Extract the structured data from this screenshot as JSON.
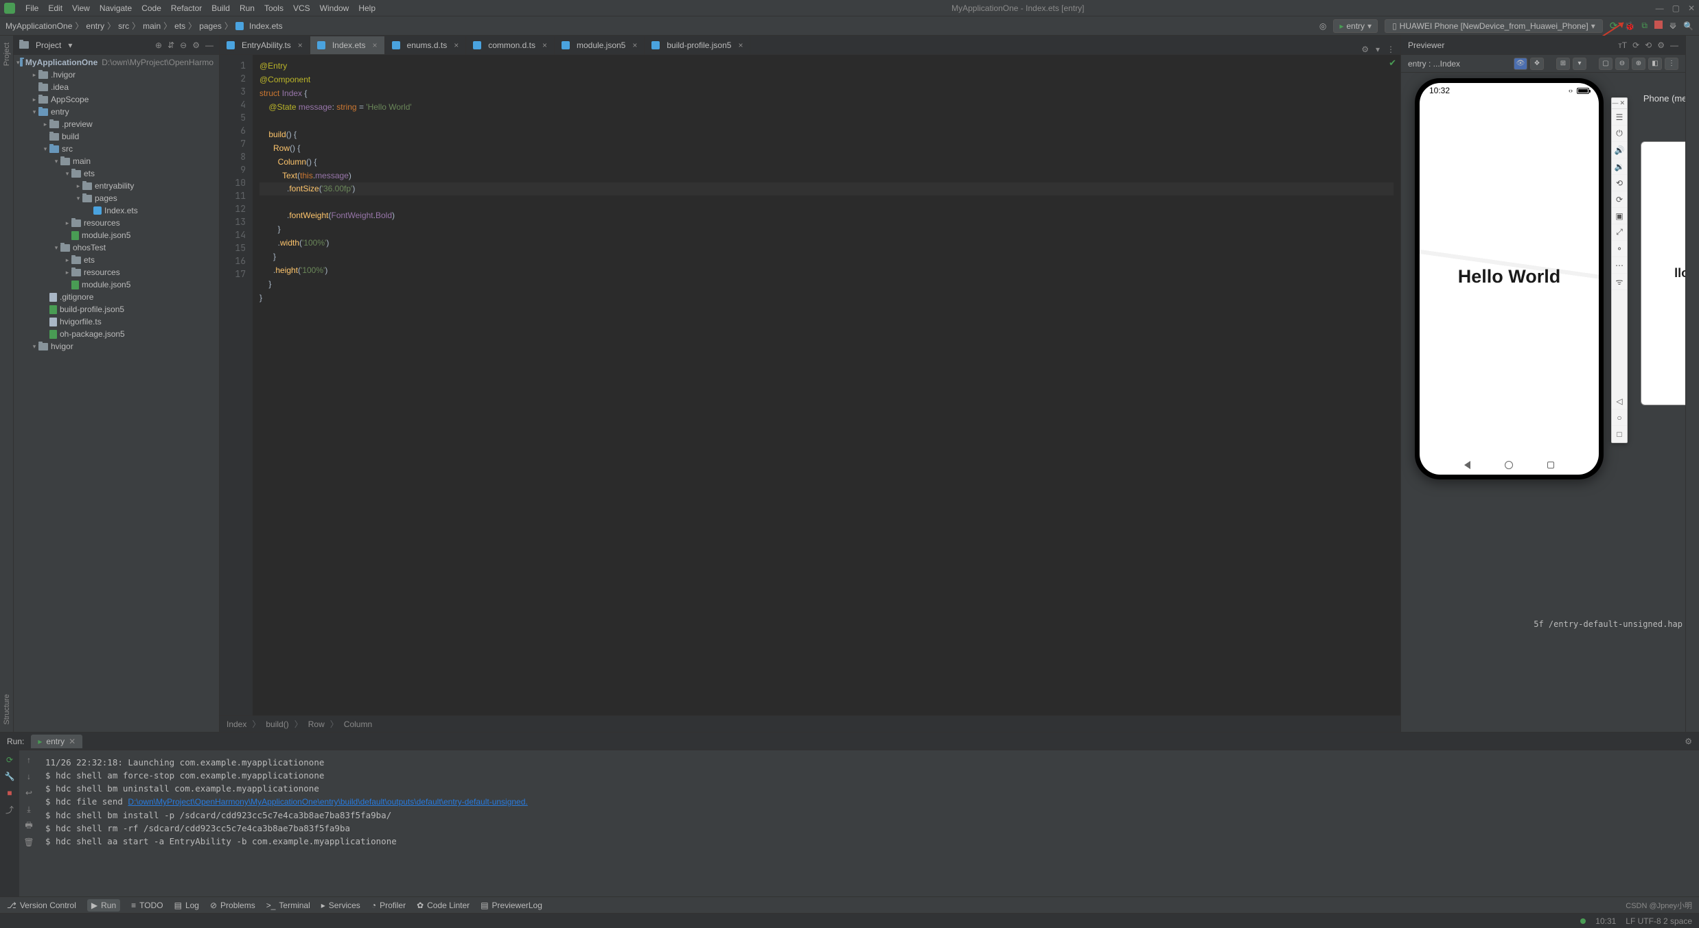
{
  "menubar": {
    "items": [
      "File",
      "Edit",
      "View",
      "Navigate",
      "Code",
      "Refactor",
      "Build",
      "Run",
      "Tools",
      "VCS",
      "Window",
      "Help"
    ],
    "title": "MyApplicationOne - Index.ets [entry]"
  },
  "nav": {
    "crumbs": [
      "MyApplicationOne",
      "entry",
      "src",
      "main",
      "ets",
      "pages",
      "Index.ets"
    ],
    "run_config": "entry",
    "device": "HUAWEI Phone [NewDevice_from_Huawei_Phone]"
  },
  "project": {
    "header": "Project",
    "root": {
      "name": "MyApplicationOne",
      "path": "D:\\own\\MyProject\\OpenHarmo"
    },
    "tree": [
      {
        "d": 1,
        "a": "▸",
        "t": "folder",
        "n": ".hvigor"
      },
      {
        "d": 1,
        "a": " ",
        "t": "folder",
        "n": ".idea"
      },
      {
        "d": 1,
        "a": "▸",
        "t": "folder",
        "n": "AppScope"
      },
      {
        "d": 1,
        "a": "▾",
        "t": "folder-blue",
        "n": "entry"
      },
      {
        "d": 2,
        "a": "▸",
        "t": "folder",
        "n": ".preview"
      },
      {
        "d": 2,
        "a": " ",
        "t": "folder",
        "n": "build"
      },
      {
        "d": 2,
        "a": "▾",
        "t": "folder-blue",
        "n": "src"
      },
      {
        "d": 3,
        "a": "▾",
        "t": "folder",
        "n": "main"
      },
      {
        "d": 4,
        "a": "▾",
        "t": "folder",
        "n": "ets"
      },
      {
        "d": 5,
        "a": "▸",
        "t": "folder",
        "n": "entryability"
      },
      {
        "d": 5,
        "a": "▾",
        "t": "folder",
        "n": "pages"
      },
      {
        "d": 6,
        "a": " ",
        "t": "ark",
        "n": "Index.ets"
      },
      {
        "d": 4,
        "a": "▸",
        "t": "folder",
        "n": "resources"
      },
      {
        "d": 4,
        "a": " ",
        "t": "hap",
        "n": "module.json5"
      },
      {
        "d": 3,
        "a": "▾",
        "t": "folder",
        "n": "ohosTest"
      },
      {
        "d": 4,
        "a": "▸",
        "t": "folder",
        "n": "ets"
      },
      {
        "d": 4,
        "a": "▸",
        "t": "folder",
        "n": "resources"
      },
      {
        "d": 4,
        "a": " ",
        "t": "hap",
        "n": "module.json5"
      },
      {
        "d": 2,
        "a": " ",
        "t": "file",
        "n": ".gitignore"
      },
      {
        "d": 2,
        "a": " ",
        "t": "hap",
        "n": "build-profile.json5"
      },
      {
        "d": 2,
        "a": " ",
        "t": "file",
        "n": "hvigorfile.ts"
      },
      {
        "d": 2,
        "a": " ",
        "t": "hap",
        "n": "oh-package.json5"
      },
      {
        "d": 1,
        "a": "▾",
        "t": "folder",
        "n": "hvigor"
      }
    ]
  },
  "tabs": [
    {
      "name": "EntryAbility.ts",
      "active": false
    },
    {
      "name": "Index.ets",
      "active": true
    },
    {
      "name": "enums.d.ts",
      "active": false
    },
    {
      "name": "common.d.ts",
      "active": false
    },
    {
      "name": "module.json5",
      "active": false
    },
    {
      "name": "build-profile.json5",
      "active": false
    }
  ],
  "code": {
    "lines": [
      "@Entry",
      "@Component",
      "struct Index {",
      "    @State message: string = 'Hello World'",
      "",
      "    build() {",
      "      Row() {",
      "        Column() {",
      "          Text(this.message)",
      "            .fontSize('36.00fp')",
      "            .fontWeight(FontWeight.Bold)",
      "        }",
      "        .width('100%')",
      "      }",
      "      .height('100%')",
      "    }",
      "}"
    ],
    "highlighted_line": 10,
    "breadcrumb": [
      "Index",
      "build()",
      "Row",
      "Column"
    ]
  },
  "previewer": {
    "title": "Previewer",
    "entry_label": "entry : ...Index",
    "device_label": "Phone (medium)",
    "phone": {
      "time": "10:32",
      "text": "Hello World"
    },
    "phone2_text": "llo World"
  },
  "run": {
    "header": "Run:",
    "tab": "entry",
    "lines": [
      "11/26 22:32:18: Launching com.example.myapplicationone",
      "$ hdc shell am force-stop com.example.myapplicationone",
      "$ hdc shell bm uninstall com.example.myapplicationone",
      {
        "pre": "$ hdc file send ",
        "link": "D:\\own\\MyProject\\OpenHarmony\\MyApplicationOne\\entry\\build\\default\\outputs\\default\\entry-default-unsigned.",
        "post": ""
      },
      "$ hdc shell bm install -p /sdcard/cdd923cc5c7e4ca3b8ae7ba83f5fa9ba/",
      "$ hdc shell rm -rf /sdcard/cdd923cc5c7e4ca3b8ae7ba83f5fa9ba",
      "$ hdc shell aa start -a EntryAbility -b com.example.myapplicationone"
    ],
    "overflow_right": "5f   /entry-default-unsigned.hap"
  },
  "bottom": {
    "items": [
      "Version Control",
      "Run",
      "TODO",
      "Log",
      "Problems",
      "Terminal",
      "Services",
      "Profiler",
      "Code Linter",
      "PreviewerLog"
    ],
    "active": "Run",
    "watermark": "CSDN @Jpney小明"
  },
  "status": {
    "time": "10:31",
    "enc": "LF   UTF-8   2 space"
  }
}
